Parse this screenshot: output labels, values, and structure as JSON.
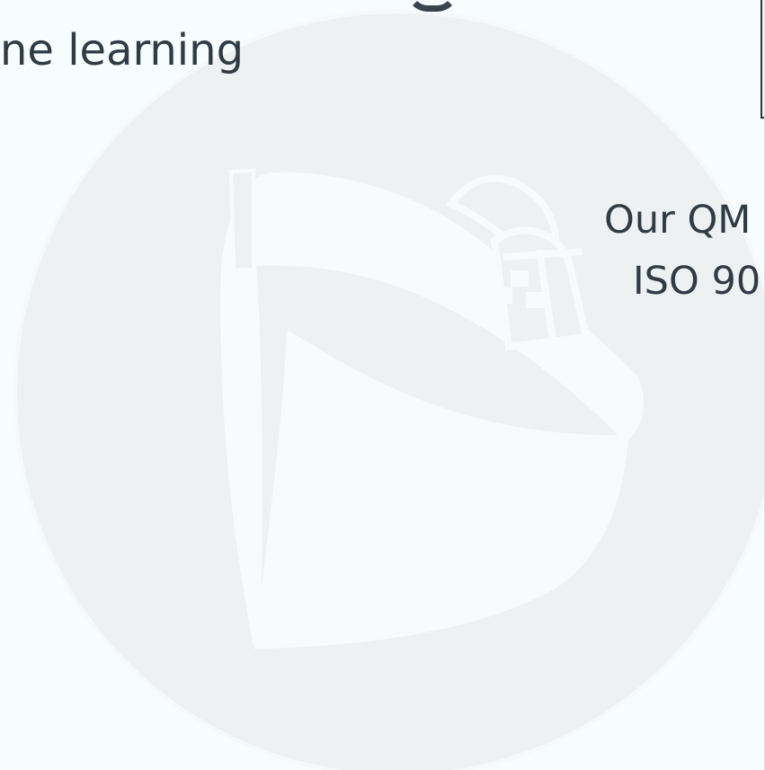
{
  "content": {
    "top_text": "ne learning",
    "right_text_1": "Our QM",
    "right_text_2": "ISO 90"
  },
  "watermark": {
    "icon": "ship-watermark-icon"
  }
}
